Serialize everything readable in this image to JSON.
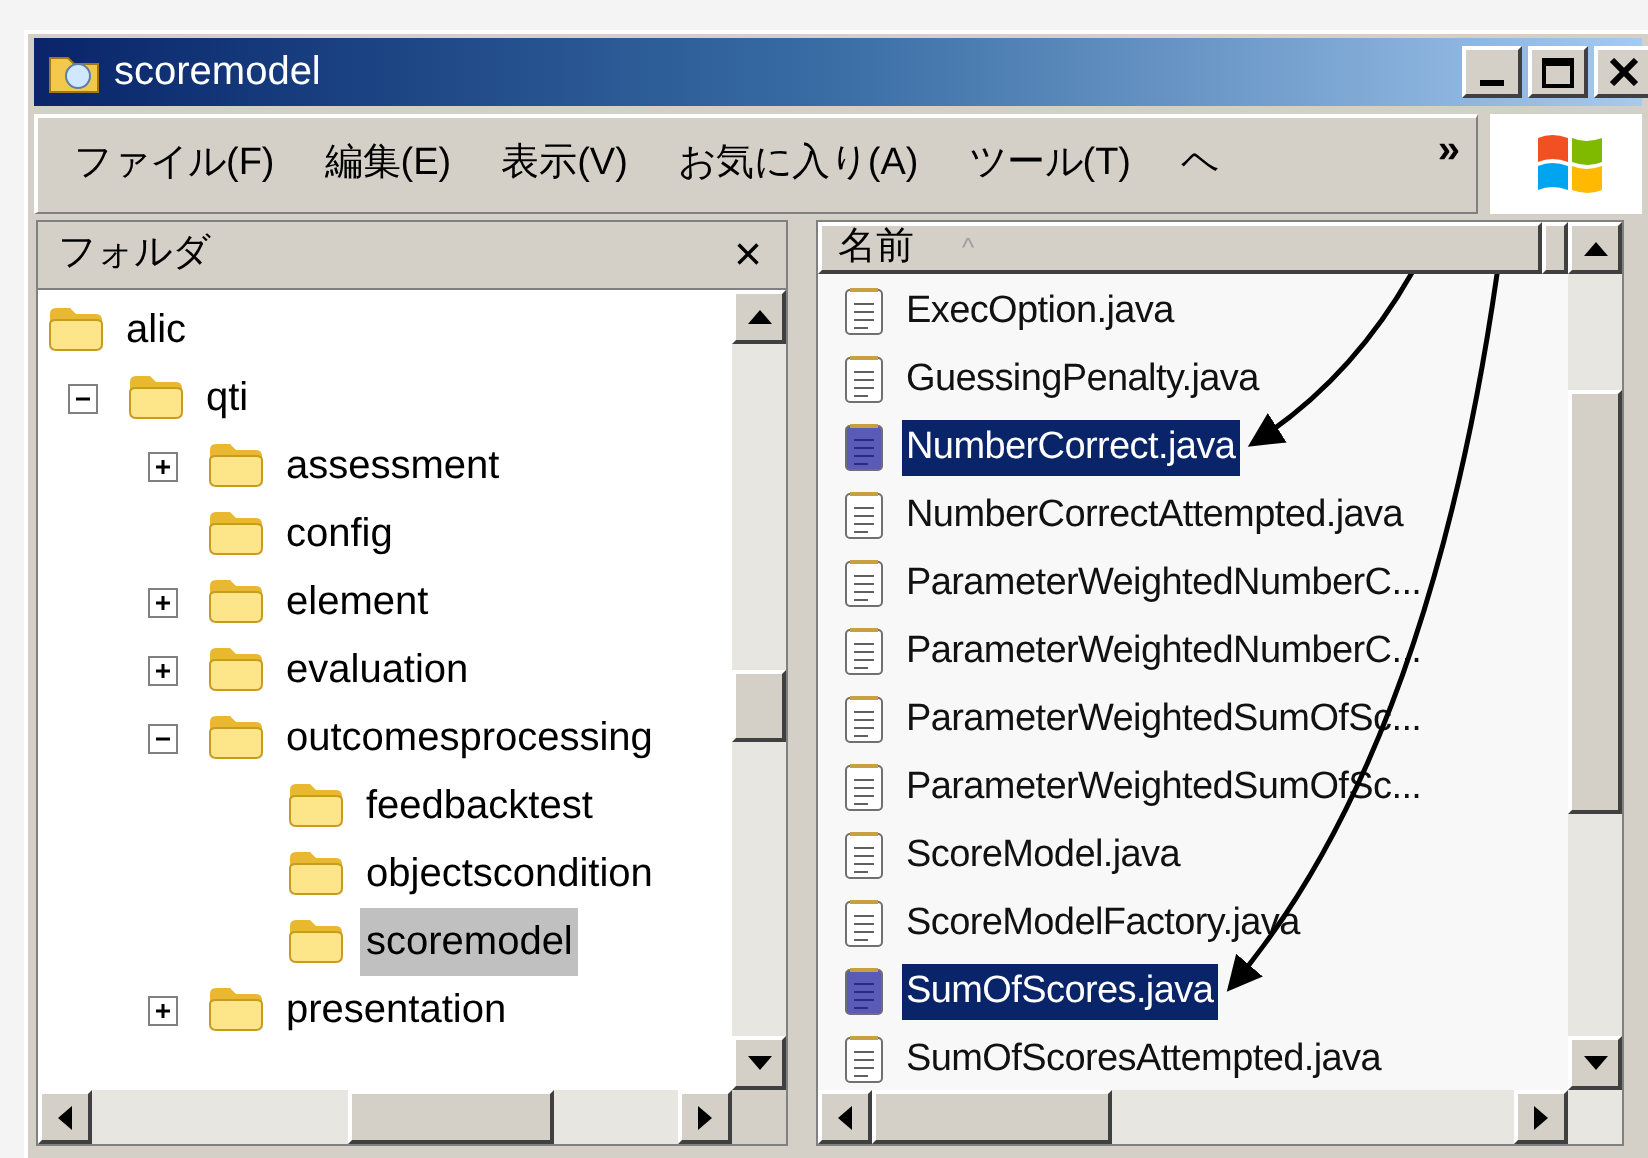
{
  "window": {
    "title": "scoremodel"
  },
  "menu": [
    "ファイル(F)",
    "編集(E)",
    "表示(V)",
    "お気に入り(A)",
    "ツール(T)",
    "ヘ"
  ],
  "menu_more": "»",
  "folder_pane": {
    "title": "フォルダ",
    "close": "×",
    "tree": [
      {
        "label": "alic",
        "selected": false,
        "children": [
          {
            "label": "qti",
            "expanded": true,
            "selected": false,
            "children": [
              {
                "label": "assessment",
                "expanded": false,
                "selected": false
              },
              {
                "label": "config",
                "selected": false
              },
              {
                "label": "element",
                "expanded": false,
                "selected": false
              },
              {
                "label": "evaluation",
                "expanded": false,
                "selected": false
              },
              {
                "label": "outcomesprocessing",
                "expanded": true,
                "selected": false,
                "children": [
                  {
                    "label": "feedbacktest",
                    "selected": false
                  },
                  {
                    "label": "objectscondition",
                    "selected": false
                  },
                  {
                    "label": "scoremodel",
                    "selected": true
                  }
                ]
              },
              {
                "label": "presentation",
                "expanded": false,
                "selected": false
              }
            ]
          }
        ]
      }
    ]
  },
  "file_list": {
    "column": "名前",
    "sort_indicator": "^",
    "files": [
      {
        "name": "ExecOption.java",
        "selected": false,
        "arrow": false
      },
      {
        "name": "GuessingPenalty.java",
        "selected": false,
        "arrow": false
      },
      {
        "name": "NumberCorrect.java",
        "selected": true,
        "arrow": true
      },
      {
        "name": "NumberCorrectAttempted.java",
        "selected": false,
        "arrow": false
      },
      {
        "name": "ParameterWeightedNumberC...",
        "selected": false,
        "arrow": false
      },
      {
        "name": "ParameterWeightedNumberC...",
        "selected": false,
        "arrow": false
      },
      {
        "name": "ParameterWeightedSumOfSc...",
        "selected": false,
        "arrow": false
      },
      {
        "name": "ParameterWeightedSumOfSc...",
        "selected": false,
        "arrow": false
      },
      {
        "name": "ScoreModel.java",
        "selected": false,
        "arrow": false
      },
      {
        "name": "ScoreModelFactory.java",
        "selected": false,
        "arrow": false
      },
      {
        "name": "SumOfScores.java",
        "selected": true,
        "arrow": true
      },
      {
        "name": "SumOfScoresAttempted.java",
        "selected": false,
        "arrow": false
      }
    ]
  }
}
